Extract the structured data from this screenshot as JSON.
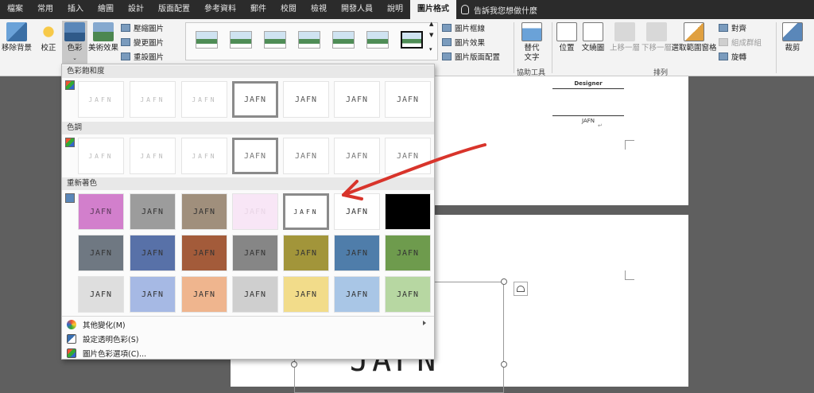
{
  "tabs": [
    "檔案",
    "常用",
    "插入",
    "繪圖",
    "設計",
    "版面配置",
    "參考資料",
    "郵件",
    "校閱",
    "檢視",
    "開發人員",
    "說明",
    "圖片格式"
  ],
  "tell_me": "告訴我您想做什麼",
  "ribbon": {
    "remove_bg": "移除背景",
    "corrections": "校正",
    "color": "色彩",
    "artistic": "美術效果",
    "compress": "壓縮圖片",
    "change_pic": "變更圖片",
    "reset_pic": "重設圖片",
    "border": "圖片框線",
    "effects": "圖片效果",
    "layout": "圖片版面配置",
    "alt_text_1": "替代",
    "alt_text_2": "文字",
    "accessibility_group": "協助工具",
    "position": "位置",
    "wrap_text": "文繞圖",
    "bring_forward": "上移一層",
    "send_backward": "下移一層",
    "selection_pane": "選取範圍窗格",
    "align": "對齊",
    "group": "組成群組",
    "rotate": "旋轉",
    "arrange_group": "排列",
    "crop": "裁剪"
  },
  "dropdown": {
    "saturation_header": "色彩飽和度",
    "tone_header": "色調",
    "recolor_header": "重新著色",
    "swatch_text": "JAFN",
    "more_variations": "其他變化(M)",
    "set_transparent": "設定透明色彩(S)",
    "color_options": "圖片色彩選項(C)..."
  },
  "recolor_colors": [
    [
      "#d27fcc",
      "#9c9c9c",
      "#a08f7c",
      "#f8e6f6",
      "#ffffff",
      "#ffffff",
      "#000000"
    ],
    [
      "#6f7882",
      "#5871a8",
      "#a35b3a",
      "#868686",
      "#a2953a",
      "#4f7daa",
      "#6e9b4d"
    ],
    [
      "#dedede",
      "#a6b9e4",
      "#efb58e",
      "#cfcfcf",
      "#f2dc8a",
      "#a9c6e6",
      "#b7d7a2"
    ]
  ],
  "document": {
    "designer": "Designer",
    "small_name": "JAFN",
    "big_text": "JAFN"
  },
  "accent_red": "#d8342b"
}
